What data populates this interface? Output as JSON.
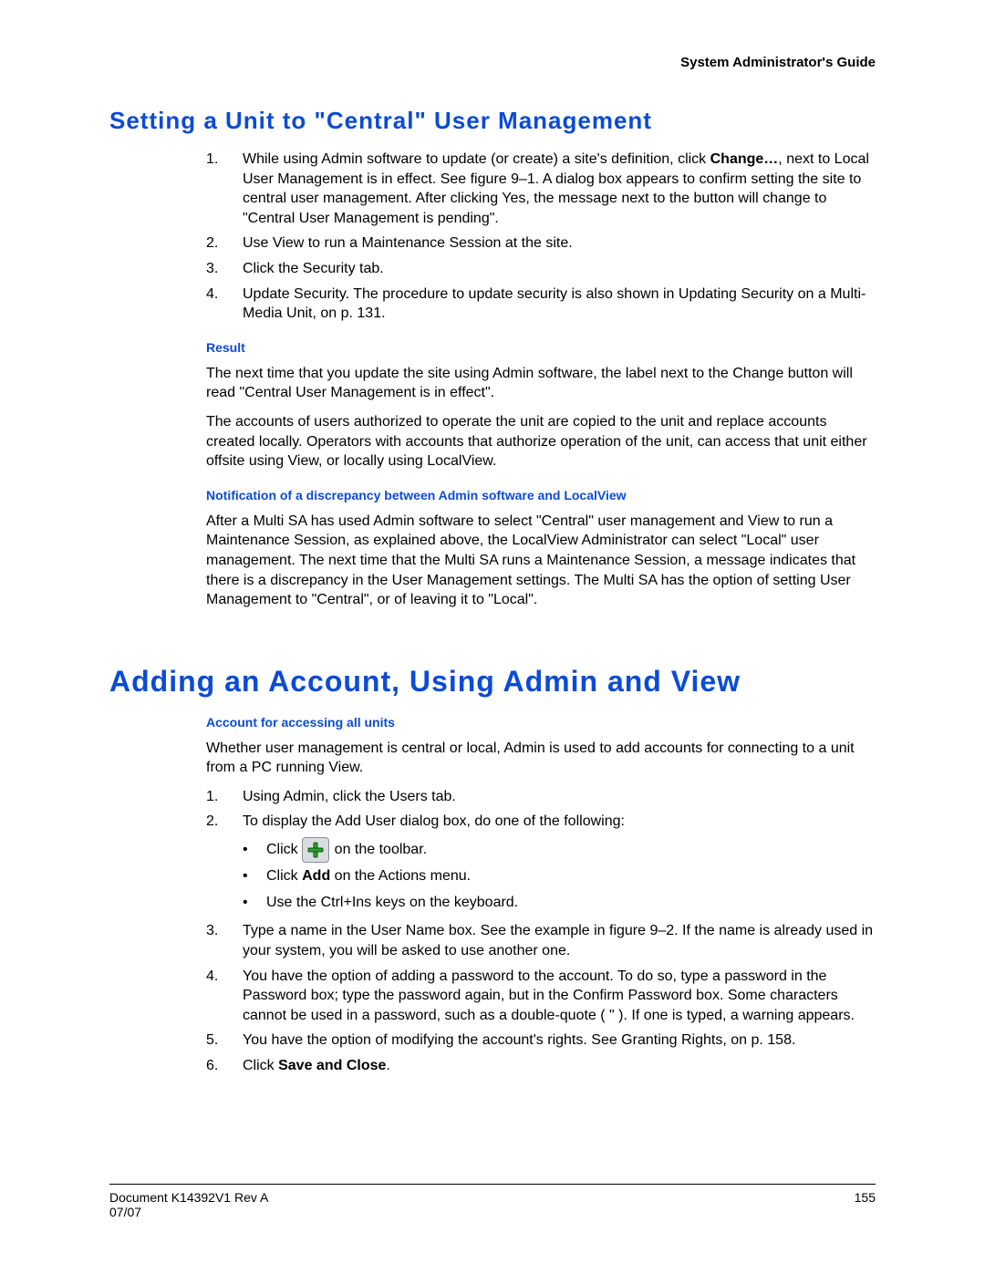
{
  "header": {
    "guide_title": "System Administrator's Guide"
  },
  "section1": {
    "title": "Setting a Unit to \"Central\" User Management",
    "steps": [
      {
        "n": "1.",
        "pre": "While using Admin software to update (or create) a site's definition, click ",
        "bold": "Change…",
        "post": ", next to Local User Management is in effect. See figure 9–1. A dialog box appears to confirm setting the site to central user management. After clicking Yes, the message next to the button will change to \"Central User Management is pending\"."
      },
      {
        "n": "2.",
        "text": "Use View to run a Maintenance Session at the site."
      },
      {
        "n": "3.",
        "text": "Click the Security tab."
      },
      {
        "n": "4.",
        "text": "Update Security. The procedure to update security is also shown in Updating Security on a Multi-Media Unit, on p. 131."
      }
    ],
    "result_label": "Result",
    "result_p1": "The next time that you update the site using Admin software, the label next to the Change button will read \"Central User Management is in effect\".",
    "result_p2": "The accounts of users authorized to operate the unit are copied to the unit and replace accounts created locally. Operators with accounts that authorize operation of the unit, can access that unit either offsite using View, or locally using LocalView.",
    "discrepancy_label": "Notification of a discrepancy between Admin software and LocalView",
    "discrepancy_text": "After a Multi SA has used Admin software to select \"Central\" user management and View to run a Maintenance Session, as explained above, the LocalView Administrator can select \"Local\" user management. The next time that the Multi SA runs a Maintenance Session, a message indicates that there is a discrepancy in the User Management settings. The Multi SA has the option of setting User Management to \"Central\", or of leaving it to \"Local\"."
  },
  "section2": {
    "title": "Adding an Account, Using Admin and View",
    "sub_label": "Account for accessing all units",
    "intro": "Whether user management is central or local, Admin is used to add accounts for connecting to a unit from a PC running View.",
    "steps_a": [
      {
        "n": "1.",
        "text": "Using Admin, click the Users tab."
      },
      {
        "n": "2.",
        "text": "To display the Add User dialog box, do one of the following:"
      }
    ],
    "bullets": {
      "b1_pre": "Click ",
      "b1_post": " on the toolbar.",
      "b2_pre": "Click ",
      "b2_bold": "Add",
      "b2_post": " on the Actions menu.",
      "b3": "Use the Ctrl+Ins keys on the keyboard."
    },
    "steps_b": [
      {
        "n": "3.",
        "text": "Type a name in the User Name box. See the example in figure 9–2. If the name is already used in your system, you will be asked to use another one."
      },
      {
        "n": "4.",
        "text": "You have the option of adding a password to the account. To do so, type a password in the Password box; type the password again, but in the Confirm Password box. Some characters cannot be used in a password, such as a double-quote ( \" ). If one is typed, a warning appears."
      },
      {
        "n": "5.",
        "text": "You have the option of modifying the account's rights. See Granting Rights, on p. 158."
      },
      {
        "n": "6.",
        "pre": "Click ",
        "bold": "Save and Close",
        "post": "."
      }
    ]
  },
  "footer": {
    "doc_id": "Document K14392V1 Rev A",
    "page": "155",
    "date": "07/07"
  }
}
